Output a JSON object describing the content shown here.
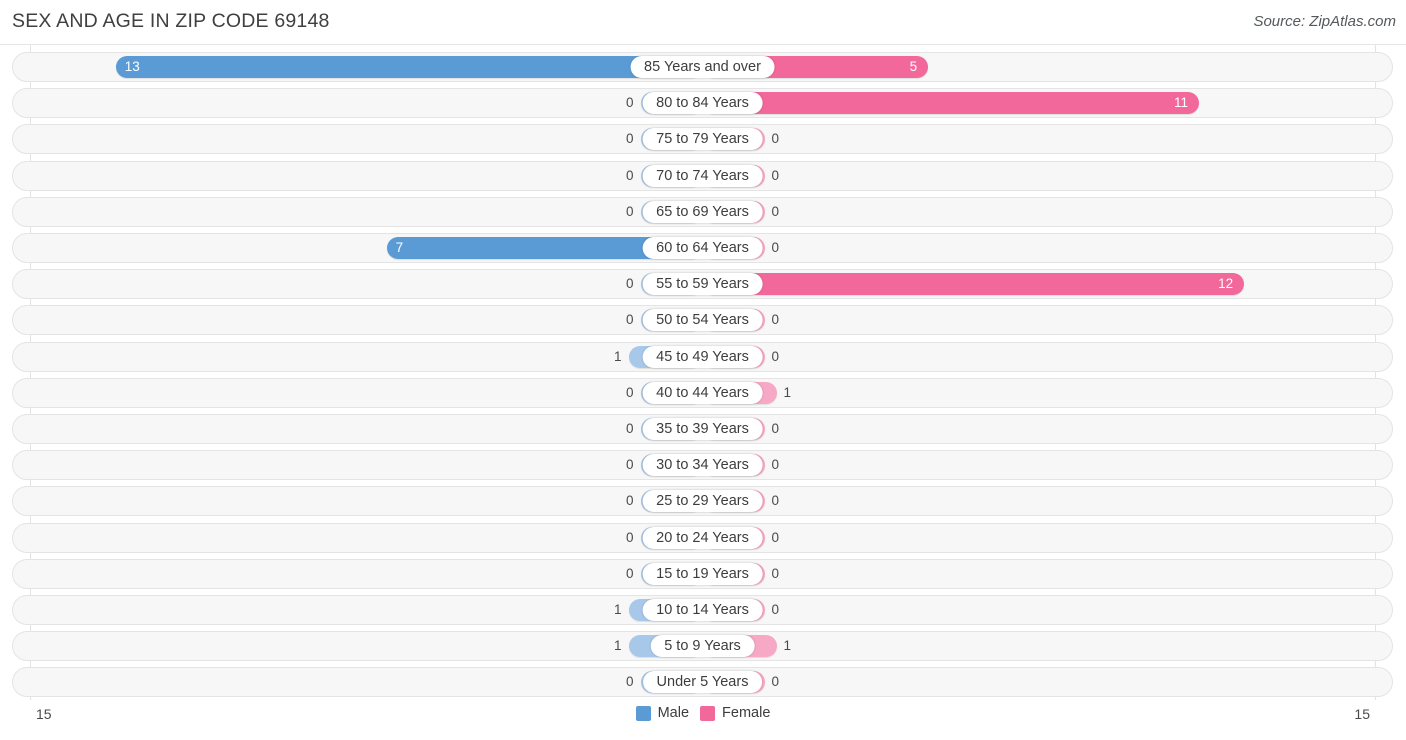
{
  "header": {
    "title": "SEX AND AGE IN ZIP CODE 69148",
    "source": "Source: ZipAtlas.com"
  },
  "legend": {
    "male": {
      "label": "Male",
      "color": "#5b9bd5"
    },
    "female": {
      "label": "Female",
      "color": "#f2689a"
    }
  },
  "axis": {
    "left_max": "15",
    "right_max": "15"
  },
  "colors": {
    "male_strong": "#5b9bd5",
    "male_pale": "#a8c8ea",
    "female_strong": "#f2689a",
    "female_pale": "#f7a8c4",
    "track_fill": "#f7f7f7",
    "track_border": "#e4e4e4",
    "gridline": "#e3e3e3"
  },
  "chart_data": {
    "type": "bar",
    "subtype": "population-pyramid",
    "title": "SEX AND AGE IN ZIP CODE 69148",
    "xlabel": "",
    "ylabel": "",
    "xlim": [
      15,
      15
    ],
    "axis_max": 15,
    "grid": true,
    "legend_position": "bottom-center",
    "categories": [
      "85 Years and over",
      "80 to 84 Years",
      "75 to 79 Years",
      "70 to 74 Years",
      "65 to 69 Years",
      "60 to 64 Years",
      "55 to 59 Years",
      "50 to 54 Years",
      "45 to 49 Years",
      "40 to 44 Years",
      "35 to 39 Years",
      "30 to 34 Years",
      "25 to 29 Years",
      "20 to 24 Years",
      "15 to 19 Years",
      "10 to 14 Years",
      "5 to 9 Years",
      "Under 5 Years"
    ],
    "series": [
      {
        "name": "Male",
        "direction": "left",
        "color": "#5b9bd5",
        "values": [
          13,
          0,
          0,
          0,
          0,
          7,
          0,
          0,
          1,
          0,
          0,
          0,
          0,
          0,
          0,
          1,
          1,
          0
        ]
      },
      {
        "name": "Female",
        "direction": "right",
        "color": "#f2689a",
        "values": [
          5,
          11,
          0,
          0,
          0,
          0,
          12,
          0,
          0,
          1,
          0,
          0,
          0,
          0,
          0,
          0,
          1,
          0
        ]
      }
    ]
  }
}
